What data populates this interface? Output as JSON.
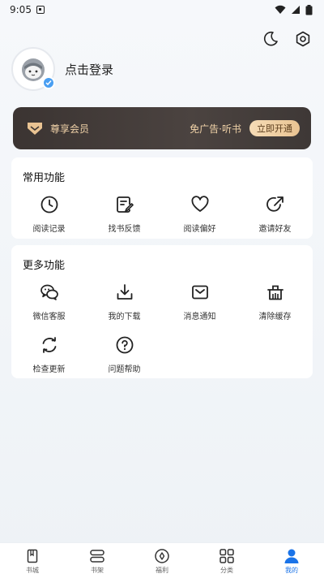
{
  "status": {
    "time": "9:05"
  },
  "profile": {
    "login_label": "点击登录"
  },
  "vip": {
    "title": "尊享会员",
    "desc": "免广告·听书",
    "button": "立即开通"
  },
  "common": {
    "title": "常用功能",
    "items": [
      {
        "label": "阅读记录",
        "icon": "clock-icon"
      },
      {
        "label": "找书反馈",
        "icon": "feedback-icon"
      },
      {
        "label": "阅读偏好",
        "icon": "heart-icon"
      },
      {
        "label": "邀请好友",
        "icon": "share-icon"
      }
    ]
  },
  "more": {
    "title": "更多功能",
    "items": [
      {
        "label": "微信客服",
        "icon": "wechat-icon"
      },
      {
        "label": "我的下载",
        "icon": "download-icon"
      },
      {
        "label": "消息通知",
        "icon": "message-icon"
      },
      {
        "label": "清除缓存",
        "icon": "clear-cache-icon"
      },
      {
        "label": "检查更新",
        "icon": "refresh-icon"
      },
      {
        "label": "问题帮助",
        "icon": "help-icon"
      }
    ]
  },
  "tabs": [
    {
      "label": "书城"
    },
    {
      "label": "书架"
    },
    {
      "label": "福利"
    },
    {
      "label": "分类"
    },
    {
      "label": "我的",
      "active": true
    }
  ],
  "colors": {
    "accent": "#1a73e8",
    "vip_bg": "#3b3432",
    "vip_text": "#f0d2a8"
  }
}
